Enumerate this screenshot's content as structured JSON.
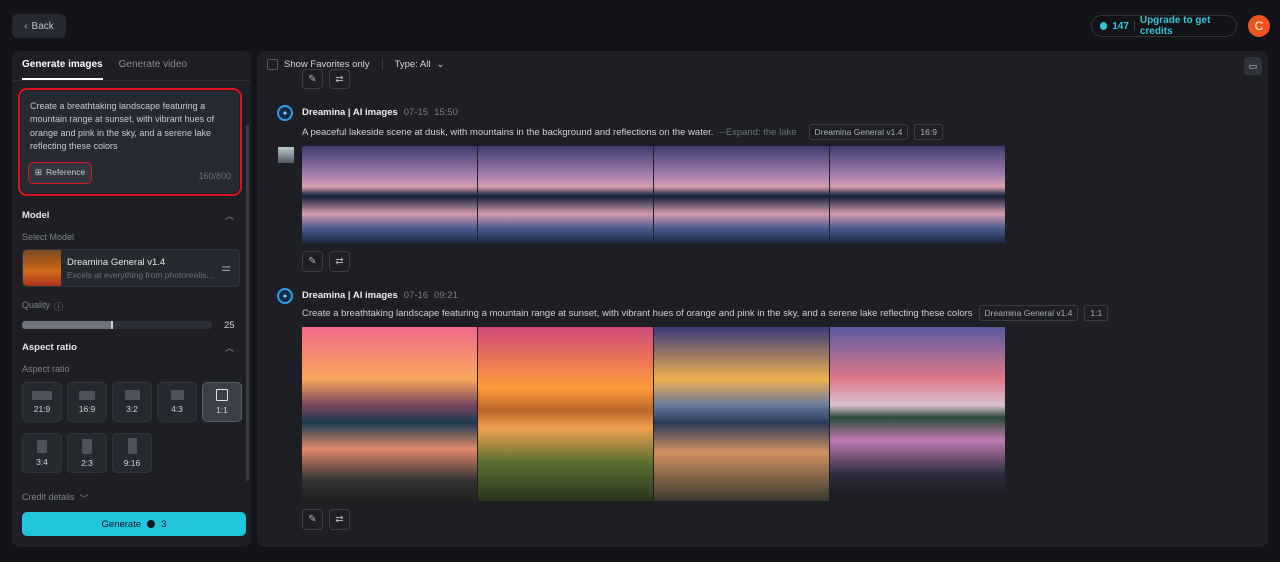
{
  "header": {
    "back_label": "Back",
    "credits": "147",
    "upgrade_label": "Upgrade to get credits",
    "avatar_initial": "C"
  },
  "left": {
    "tabs": [
      {
        "label": "Generate images"
      },
      {
        "label": "Generate video"
      }
    ],
    "prompt": "Create a breathtaking landscape featuring a mountain range at sunset, with vibrant hues of orange and pink in the sky, and a serene lake reflecting these colors",
    "reference_label": "Reference",
    "char_count": "160/800",
    "model_section": "Model",
    "select_model_label": "Select Model",
    "model_name": "Dreamina General v1.4",
    "model_desc": "Excels at everything from photorealis...",
    "quality_label": "Quality",
    "quality_value": "25",
    "quality_fraction": 0.48,
    "aspect_section": "Aspect ratio",
    "aspect_label": "Aspect ratio",
    "aspect_ratios": [
      "21:9",
      "16:9",
      "3:2",
      "4:3",
      "1:1",
      "3:4",
      "2:3",
      "9:16"
    ],
    "selected_ratio": "1:1",
    "credit_details": "Credit details",
    "generate_label": "Generate",
    "generate_cost": "3"
  },
  "right": {
    "show_favorites": "Show Favorites only",
    "type_filter": "Type: All",
    "generations": [
      {
        "author": "Dreamina | AI images",
        "date": "07-15",
        "time": "15:50",
        "prompt": "A peaceful lakeside scene at dusk, with mountains in the background and reflections on the water.",
        "expand": "--Expand: the lake",
        "model": "Dreamina General v1.4",
        "ratio": "16:9"
      },
      {
        "author": "Dreamina | AI images",
        "date": "07-16",
        "time": "09:21",
        "prompt": "Create a breathtaking landscape featuring a mountain range at sunset, with vibrant hues of orange and pink in the sky, and a serene lake reflecting these colors",
        "model": "Dreamina General v1.4",
        "ratio": "1:1"
      }
    ]
  },
  "colors": {
    "accent": "#21c4dc",
    "avatar": "#f0541e",
    "highlight": "#e0141e"
  }
}
